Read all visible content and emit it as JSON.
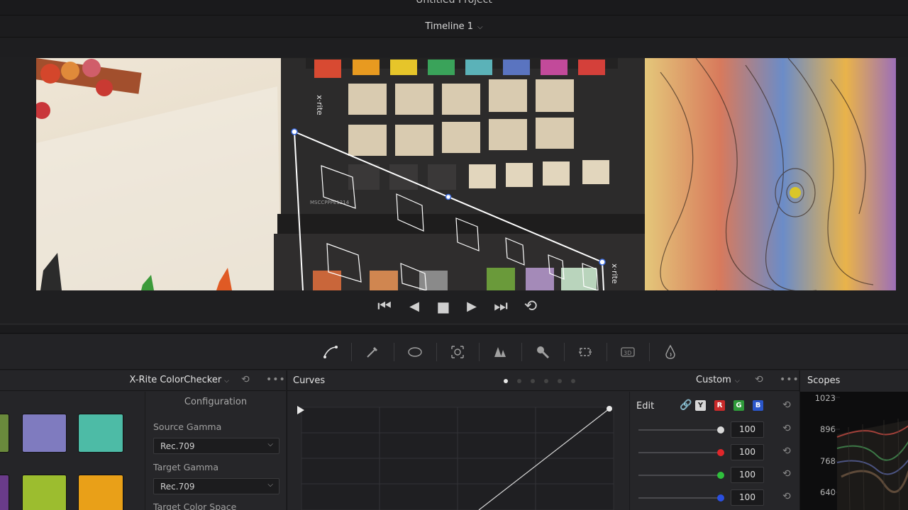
{
  "window": {
    "title": "Untitled Project"
  },
  "timeline": {
    "label": "Timeline 1",
    "chevron": "chevron-down-icon"
  },
  "viewer": {
    "chart_label": "MSCCPPPE1214",
    "brand_left": "x-rite",
    "brand_right": "x-rite"
  },
  "transport": {
    "skip_start": "⏮",
    "prev_frame": "◀",
    "stop": "■",
    "play": "▶",
    "skip_end": "⏭",
    "loop": "⟲"
  },
  "toolbar": {
    "tools": [
      "curves-icon",
      "qualifier-eyedropper-icon",
      "window-icon",
      "tracker-icon",
      "blur-icon",
      "key-icon",
      "sizing-icon",
      "3d-icon",
      "magic-mask-icon"
    ]
  },
  "colorchecker": {
    "title": "X-Rite ColorChecker",
    "config_header": "Configuration",
    "source_gamma_label": "Source Gamma",
    "source_gamma_value": "Rec.709",
    "target_gamma_label": "Target Gamma",
    "target_gamma_value": "Rec.709",
    "target_color_space_label": "Target Color Space",
    "swatch_colors": [
      "#6a8a3c",
      "#7f7bbf",
      "#4dbba6",
      "#6a3b8a",
      "#9cbd2f",
      "#e9a018"
    ]
  },
  "curves": {
    "title": "Curves",
    "mode": "Custom",
    "edit_label": "Edit",
    "channels": [
      "Y",
      "R",
      "G",
      "B"
    ],
    "rows": [
      {
        "name": "luma",
        "value": "100",
        "color": "#d8d8d8"
      },
      {
        "name": "red",
        "value": "100",
        "color": "#e0262a"
      },
      {
        "name": "green",
        "value": "100",
        "color": "#2fbf3c"
      },
      {
        "name": "blue",
        "value": "100",
        "color": "#2a4fe0"
      }
    ]
  },
  "scopes": {
    "title": "Scopes",
    "ticks": [
      "1023",
      "896",
      "768",
      "640"
    ]
  }
}
